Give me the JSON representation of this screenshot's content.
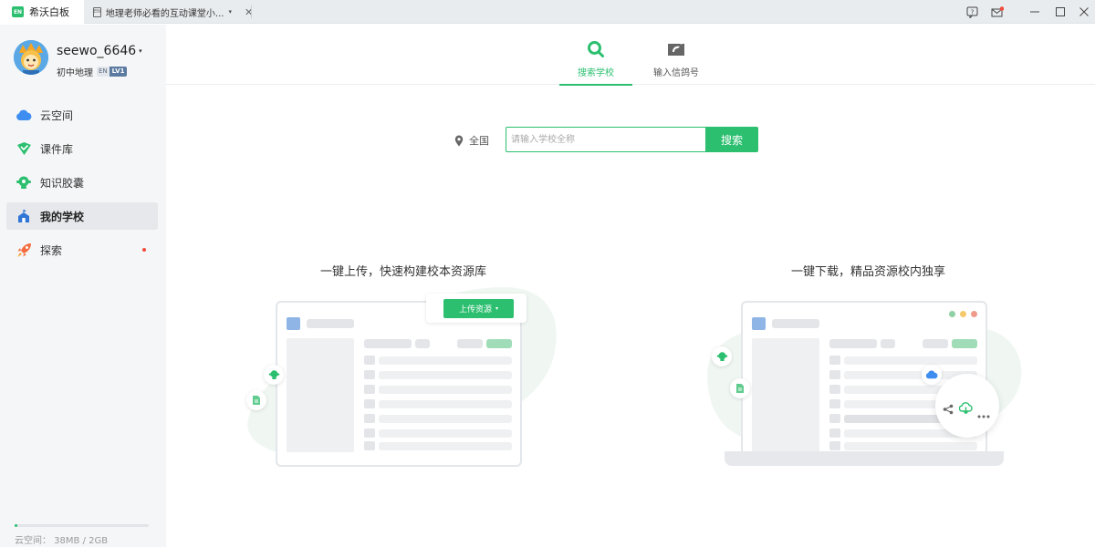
{
  "titlebar": {
    "app_name": "希沃白板",
    "app_logo_text": "EN",
    "doc_tab_title": "地理老师必看的互动课堂小...",
    "doc_tab_icon_text": "EN",
    "dropdown_glyph": "▾",
    "close_glyph": "✕",
    "help_glyph": "?",
    "min_glyph": "—",
    "max_glyph": "☐",
    "win_close_glyph": "✕"
  },
  "user": {
    "name": "seewo_6646",
    "subject": "初中地理",
    "badge_prefix": "EN",
    "level": "LV1"
  },
  "nav": [
    {
      "label": "云空间",
      "icon": "cloud-icon",
      "active": false
    },
    {
      "label": "课件库",
      "icon": "courseware-icon",
      "active": false
    },
    {
      "label": "知识胶囊",
      "icon": "capsule-icon",
      "active": false
    },
    {
      "label": "我的学校",
      "icon": "school-icon",
      "active": true
    },
    {
      "label": "探索",
      "icon": "rocket-icon",
      "active": false,
      "dot": true
    }
  ],
  "storage": {
    "text": "云空间：   38MB / 2GB",
    "used_fraction": 0.019
  },
  "main_tabs": [
    {
      "label": "搜索学校",
      "icon": "search-icon",
      "active": true
    },
    {
      "label": "输入信鸽号",
      "icon": "pigeon-icon",
      "active": false
    }
  ],
  "search": {
    "region_label": "全国",
    "placeholder": "请输入学校全称",
    "button_label": "搜索"
  },
  "features": {
    "upload_title": "一键上传，快速构建校本资源库",
    "upload_button": "上传资源",
    "download_title": "一键下载，精品资源校内独享"
  },
  "colors": {
    "accent": "#2bbf6f",
    "sidebar_bg": "#f5f6f7",
    "red_dot": "#f04b3c"
  }
}
